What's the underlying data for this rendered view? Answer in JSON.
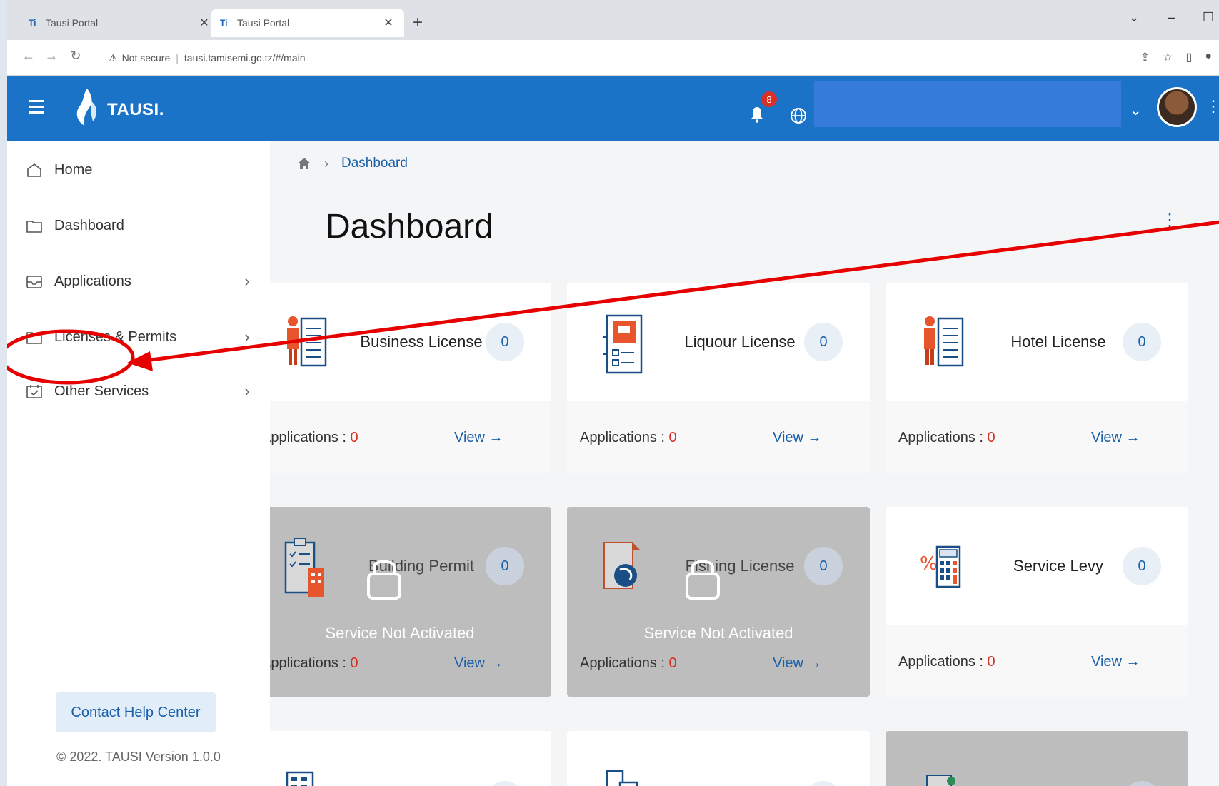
{
  "browser": {
    "tabs": [
      {
        "label": "Tausi Portal",
        "favicon": "Ti"
      },
      {
        "label": "Tausi Portal",
        "favicon": "Ti"
      }
    ],
    "new_tab": "+",
    "url_warning": "Not secure",
    "url": "tausi.tamisemi.go.tz/#/main"
  },
  "header": {
    "logo_text": "TAUSI.",
    "notification_count": "8"
  },
  "sidebar": {
    "items": [
      {
        "label": "Home",
        "icon": "home-icon"
      },
      {
        "label": "Dashboard",
        "icon": "folder-icon"
      },
      {
        "label": "Applications",
        "icon": "inbox-icon",
        "caret": "›"
      },
      {
        "label": "Licenses & Permits",
        "icon": "folder-icon",
        "caret": "›"
      },
      {
        "label": "Other Services",
        "icon": "calendar-check-icon",
        "caret": "›"
      }
    ],
    "help_button": "Contact Help Center",
    "copyright": "© 2022. TAUSI Version 1.0.0"
  },
  "main": {
    "breadcrumb": "Dashboard",
    "title": "Dashboard",
    "applications_label": "Applications : ",
    "view_label": "View →",
    "locked_label": "Service Not Activated",
    "cards": [
      {
        "title": "Business License",
        "count": "0",
        "applications": "0",
        "locked": false,
        "icon": "business-license-icon"
      },
      {
        "title": "Liquour License",
        "count": "0",
        "applications": "0",
        "locked": false,
        "icon": "liquour-license-icon"
      },
      {
        "title": "Hotel License",
        "count": "0",
        "applications": "0",
        "locked": false,
        "icon": "hotel-license-icon"
      },
      {
        "title": "Building Permit",
        "count": "0",
        "applications": "0",
        "locked": true,
        "icon": "building-permit-icon"
      },
      {
        "title": "Fishing License",
        "count": "0",
        "applications": "0",
        "locked": true,
        "icon": "fishing-license-icon"
      },
      {
        "title": "Service Levy",
        "count": "0",
        "applications": "0",
        "locked": false,
        "icon": "service-levy-icon"
      }
    ]
  },
  "colors": {
    "header": "#1a73c7",
    "accent": "#1a5fa8",
    "count_red": "#d93025",
    "annotation": "#e60000"
  }
}
